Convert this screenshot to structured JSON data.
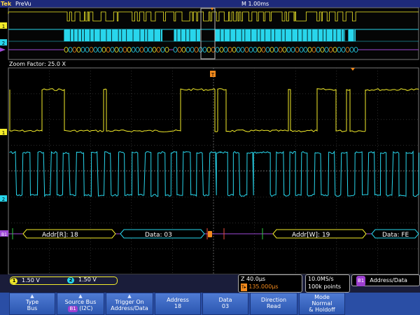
{
  "topbar": {
    "brand": "Tek",
    "mode": "PreVu",
    "timebase": "M 1.00ms"
  },
  "zoom": {
    "label": "Zoom Factor: 25.0 X"
  },
  "channels": {
    "ch1_marker": "1",
    "ch2_marker": "2",
    "bus_marker": "B1",
    "trigger_marker": "T"
  },
  "bus_frames": [
    {
      "label": "Addr[R]: 18"
    },
    {
      "label": "Data: 03"
    },
    {
      "label": "Addr[W]: 19"
    },
    {
      "label": "Data: FE"
    }
  ],
  "status": {
    "ch1_num": "1",
    "ch1_scale": "1.50 V",
    "ch2_num": "2",
    "ch2_scale": "1.50 V",
    "zoom_scale": "Z 40.0µs",
    "trigger_pos": "135.000µs",
    "sample_rate": "10.0MS/s",
    "record_length": "100k points",
    "bus_num": "B1",
    "bus_display": "Address/Data"
  },
  "menu": {
    "type_label": "Type",
    "type_value": "Bus",
    "source_label": "Source Bus",
    "source_bus": "B1",
    "source_value": "(I2C)",
    "trigger_label": "Trigger On",
    "trigger_value": "Address/Data",
    "address_label": "Address",
    "address_value": "18",
    "data_label": "Data",
    "data_value": "03",
    "direction_label": "Direction",
    "direction_value": "Read",
    "mode_label": "Mode",
    "mode_value1": "Normal",
    "mode_value2": "& Holdoff"
  },
  "colors": {
    "ch1": "#f3ec2a",
    "ch2": "#28d6ec",
    "bus": "#a04ad8",
    "grid": "#4a4a4a",
    "accent": "#f28a1d"
  }
}
